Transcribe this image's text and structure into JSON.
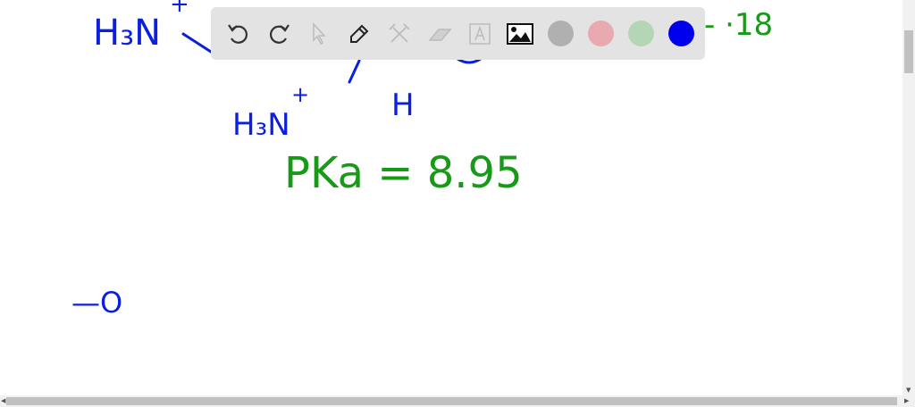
{
  "drawing": {
    "h3n_top": "H₃N",
    "plus_top": "+",
    "h3n_bottom": "H₃N",
    "plus_bottom": "+",
    "h_label": "H",
    "pka": "PKa = 8.95",
    "value_partial": "- ·18",
    "minus_o": "—O"
  },
  "toolbar": {
    "tools": [
      "undo-icon",
      "redo-icon",
      "select-icon",
      "pen-icon",
      "tools-icon",
      "eraser-icon",
      "text-icon",
      "image-icon"
    ],
    "colors": [
      "#b0b0b0",
      "#e8a9b0",
      "#b4d6b4",
      "#0000ee"
    ],
    "selected_color": "#0000ee"
  }
}
